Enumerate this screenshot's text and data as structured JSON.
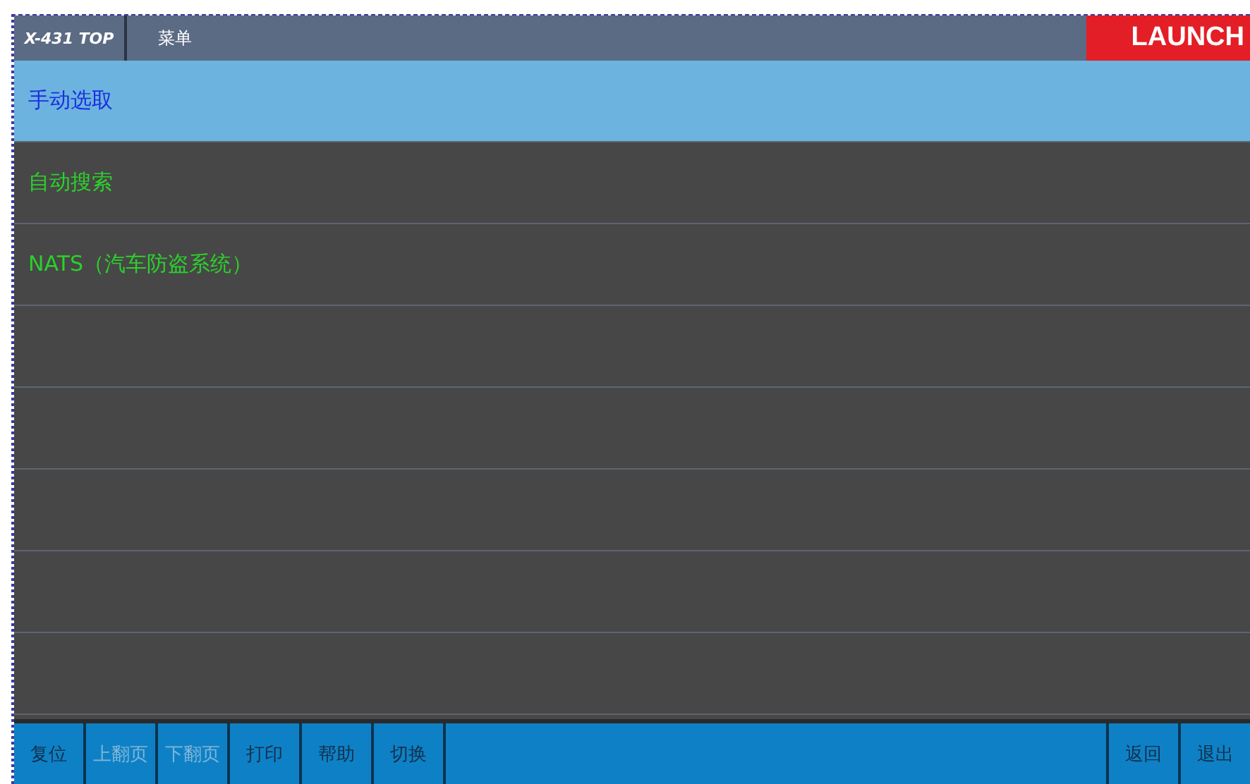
{
  "header": {
    "logo": "X-431 TOP",
    "title": "菜单",
    "brand": "LAUNCH"
  },
  "menu": [
    {
      "label": "手动选取",
      "selected": true
    },
    {
      "label": "自动搜索",
      "selected": false
    },
    {
      "label": "NATS（汽车防盗系统）",
      "selected": false
    }
  ],
  "toolbar_left": [
    {
      "label": "复位",
      "disabled": false
    },
    {
      "label": "上翻页",
      "disabled": true
    },
    {
      "label": "下翻页",
      "disabled": true
    },
    {
      "label": "打印",
      "disabled": false
    },
    {
      "label": "帮助",
      "disabled": false
    },
    {
      "label": "切换",
      "disabled": false
    }
  ],
  "toolbar_right": [
    {
      "label": "返回",
      "disabled": false
    },
    {
      "label": "退出",
      "disabled": false
    }
  ]
}
